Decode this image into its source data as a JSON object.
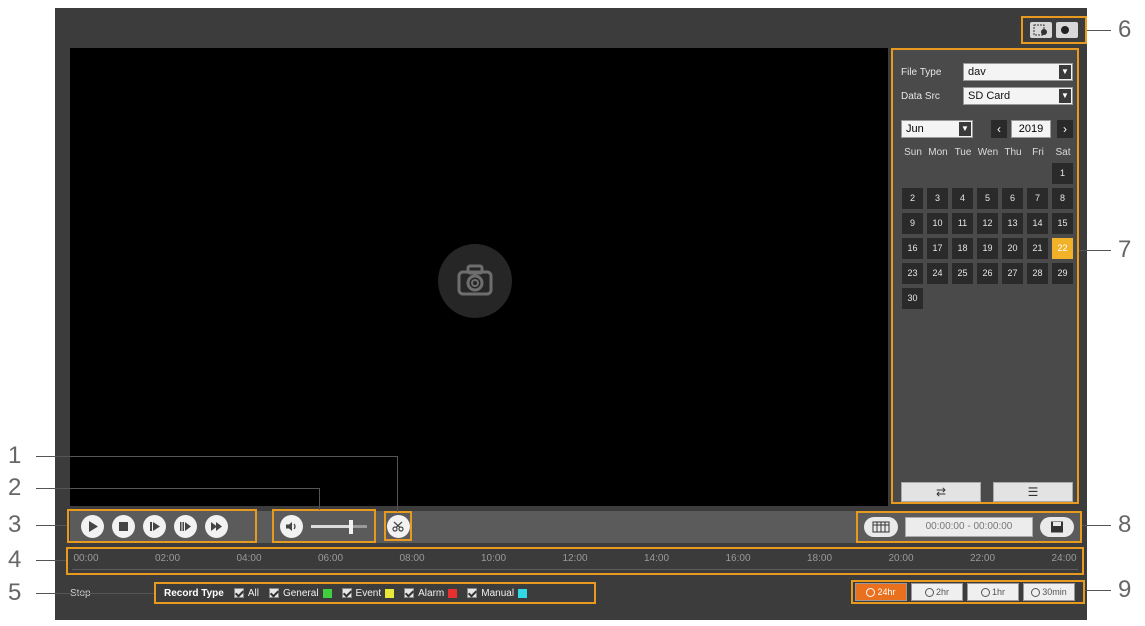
{
  "top_icons": [
    "video-window-icon",
    "record-dot-icon"
  ],
  "panel": {
    "file_type_label": "File Type",
    "file_type_value": "dav",
    "data_src_label": "Data Src",
    "data_src_value": "SD Card",
    "month": "Jun",
    "year": "2019",
    "weekdays": [
      "Sun",
      "Mon",
      "Tue",
      "Wen",
      "Thu",
      "Fri",
      "Sat"
    ],
    "days": [
      "1",
      "2",
      "3",
      "4",
      "5",
      "6",
      "7",
      "8",
      "9",
      "10",
      "11",
      "12",
      "13",
      "14",
      "15",
      "16",
      "17",
      "18",
      "19",
      "20",
      "21",
      "22",
      "23",
      "24",
      "25",
      "26",
      "27",
      "28",
      "29",
      "30"
    ],
    "selected_day": "22",
    "first_weekday_index": 6,
    "accent_color": "#f1b22a"
  },
  "download": {
    "time_range": "00:00:00 - 00:00:00"
  },
  "timeline": {
    "ticks": [
      "00:00",
      "02:00",
      "04:00",
      "06:00",
      "08:00",
      "10:00",
      "12:00",
      "14:00",
      "16:00",
      "18:00",
      "20:00",
      "22:00",
      "24:00"
    ]
  },
  "status": "Stop",
  "record_type": {
    "title": "Record Type",
    "items": [
      {
        "label": "All",
        "color": ""
      },
      {
        "label": "General",
        "color": "#3fcf3f"
      },
      {
        "label": "Event",
        "color": "#e8e83a"
      },
      {
        "label": "Alarm",
        "color": "#e83030"
      },
      {
        "label": "Manual",
        "color": "#30d8e8"
      }
    ]
  },
  "time_scale": [
    {
      "label": "24hr",
      "active": true
    },
    {
      "label": "2hr",
      "active": false
    },
    {
      "label": "1hr",
      "active": false
    },
    {
      "label": "30min",
      "active": false
    }
  ],
  "callouts": [
    "1",
    "2",
    "3",
    "4",
    "5",
    "6",
    "7",
    "8",
    "9"
  ]
}
